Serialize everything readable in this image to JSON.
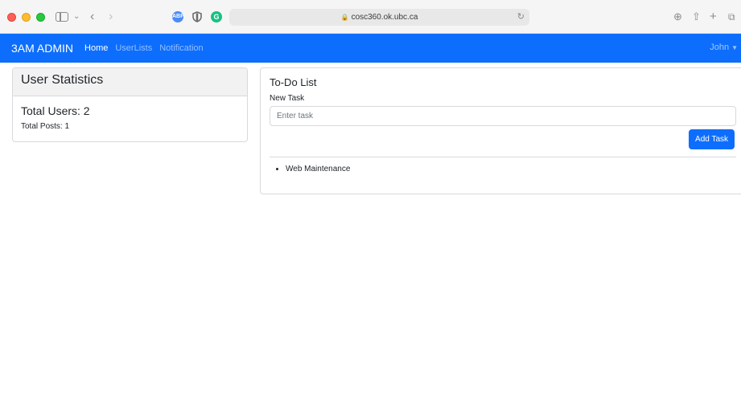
{
  "browser": {
    "url": "cosc360.ok.ubc.ca",
    "extensions": [
      "ABP",
      "G"
    ]
  },
  "navbar": {
    "brand": "3AM ADMIN",
    "links": [
      {
        "label": "Home",
        "active": true
      },
      {
        "label": "UserLists",
        "active": false
      },
      {
        "label": "Notification",
        "active": false
      }
    ],
    "user": "John"
  },
  "stats": {
    "title": "User Statistics",
    "total_users": "Total Users: 2",
    "total_posts": "Total Posts: 1"
  },
  "todo": {
    "title": "To-Do List",
    "label": "New Task",
    "placeholder": "Enter task",
    "button": "Add Task",
    "items": [
      "Web Maintenance"
    ]
  },
  "colors": {
    "primary": "#0d6efd"
  }
}
